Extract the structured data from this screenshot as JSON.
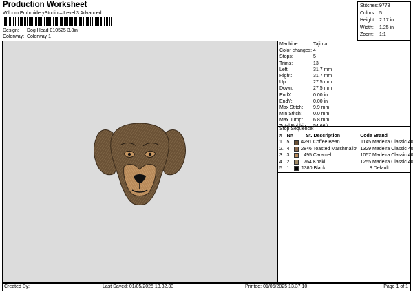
{
  "header": {
    "title": "Production Worksheet",
    "subtitle": "Wilcom EmbroideryStudio – Level 3 Advanced",
    "design_label": "Design:",
    "design_value": "Dog Head 010525 3,8in",
    "colorway_label": "Colorway:",
    "colorway_value": "Colorway 1"
  },
  "summary": [
    {
      "label": "Stitches:",
      "value": "9778"
    },
    {
      "label": "Colors:",
      "value": "5"
    },
    {
      "label": "Height:",
      "value": "2.17 in"
    },
    {
      "label": "Width:",
      "value": "1.25 in"
    },
    {
      "label": "Zoom:",
      "value": "1:1"
    }
  ],
  "machine_info": [
    {
      "label": "Machine:",
      "value": "Tajima"
    },
    {
      "label": "Color changes:",
      "value": "4"
    },
    {
      "label": "Stops:",
      "value": "5"
    },
    {
      "label": "Trims:",
      "value": "13"
    },
    {
      "label": "Left:",
      "value": "31.7 mm"
    },
    {
      "label": "Right:",
      "value": "31.7 mm"
    },
    {
      "label": "Up:",
      "value": "27.5 mm"
    },
    {
      "label": "Down:",
      "value": "27.5 mm"
    },
    {
      "label": "EndX:",
      "value": "0.00 in"
    },
    {
      "label": "EndY:",
      "value": "0.00 in"
    },
    {
      "label": "Max Stitch:",
      "value": "9.9 mm"
    },
    {
      "label": "Min Stitch:",
      "value": "0.0 mm"
    },
    {
      "label": "Max Jump:",
      "value": "6.8 mm"
    },
    {
      "label": "Total Bobbin:",
      "value": "54.66ft"
    }
  ],
  "stop_sequence": {
    "title": "Stop Sequence:",
    "headers": {
      "num": "#",
      "n": "N#",
      "st": "St.",
      "desc": "Description",
      "code": "Code",
      "brand": "Brand"
    },
    "rows": [
      {
        "num": "1.",
        "n": "5",
        "color": "#6b5236",
        "st": "4291",
        "desc": "Coffee Bean",
        "code": "1145",
        "brand": "Madeira Classic 40"
      },
      {
        "num": "2.",
        "n": "4",
        "color": "#8b6a4e",
        "st": "2846",
        "desc": "Toasted Marshmallow",
        "code": "1329",
        "brand": "Madeira Classic 40"
      },
      {
        "num": "3.",
        "n": "3",
        "color": "#b88a5a",
        "st": "495",
        "desc": "Caramel",
        "code": "1057",
        "brand": "Madeira Classic 40"
      },
      {
        "num": "4.",
        "n": "2",
        "color": "#9e8a67",
        "st": "764",
        "desc": "Khaki",
        "code": "1255",
        "brand": "Madeira Classic 40"
      },
      {
        "num": "5.",
        "n": "1",
        "color": "#000000",
        "st": "1380",
        "desc": "Black",
        "code": "8",
        "brand": "Default"
      }
    ]
  },
  "footer": {
    "created_by": "Created By:",
    "last_saved": "Last Saved: 01/05/2025 13.32.33",
    "printed": "Printed: 01/05/2025 13.37.10",
    "page": "Page 1 of 1"
  }
}
